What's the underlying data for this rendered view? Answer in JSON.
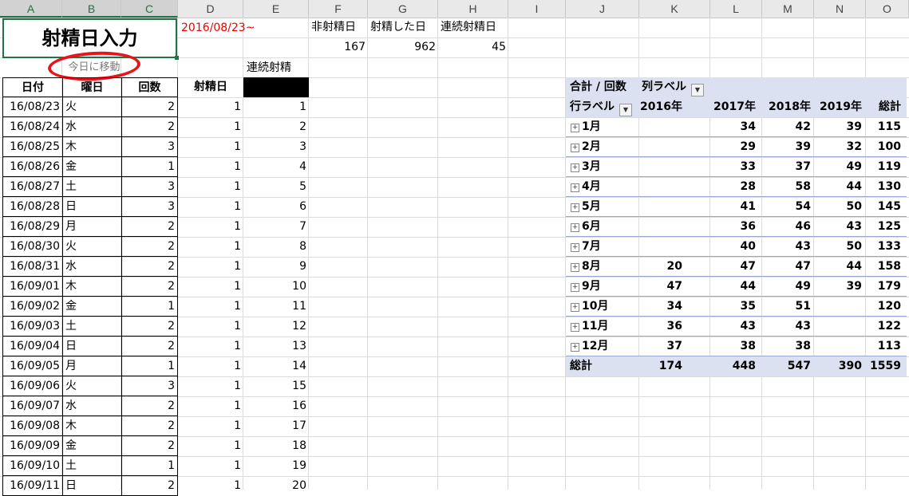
{
  "columns": [
    "A",
    "B",
    "C",
    "D",
    "E",
    "F",
    "G",
    "H",
    "I",
    "J",
    "K",
    "L",
    "M",
    "N",
    "O"
  ],
  "title": "射精日入力",
  "date_start": "2016/08/23~",
  "today_link": "今日に移動",
  "stats": {
    "labels": [
      "非射精日",
      "射精した日",
      "連続射精日"
    ],
    "values": [
      "167",
      "962",
      "45"
    ]
  },
  "streak_label": "連続射精",
  "headers": {
    "date": "日付",
    "weekday": "曜日",
    "count": "回数",
    "ejac_day": "射精日"
  },
  "rows": [
    {
      "date": "16/08/23",
      "weekday": "火",
      "count": "2",
      "day": "1",
      "streak": "1"
    },
    {
      "date": "16/08/24",
      "weekday": "水",
      "count": "2",
      "day": "1",
      "streak": "2"
    },
    {
      "date": "16/08/25",
      "weekday": "木",
      "count": "3",
      "day": "1",
      "streak": "3"
    },
    {
      "date": "16/08/26",
      "weekday": "金",
      "count": "1",
      "day": "1",
      "streak": "4"
    },
    {
      "date": "16/08/27",
      "weekday": "土",
      "count": "3",
      "day": "1",
      "streak": "5"
    },
    {
      "date": "16/08/28",
      "weekday": "日",
      "count": "3",
      "day": "1",
      "streak": "6"
    },
    {
      "date": "16/08/29",
      "weekday": "月",
      "count": "2",
      "day": "1",
      "streak": "7"
    },
    {
      "date": "16/08/30",
      "weekday": "火",
      "count": "2",
      "day": "1",
      "streak": "8"
    },
    {
      "date": "16/08/31",
      "weekday": "水",
      "count": "2",
      "day": "1",
      "streak": "9"
    },
    {
      "date": "16/09/01",
      "weekday": "木",
      "count": "2",
      "day": "1",
      "streak": "10"
    },
    {
      "date": "16/09/02",
      "weekday": "金",
      "count": "1",
      "day": "1",
      "streak": "11"
    },
    {
      "date": "16/09/03",
      "weekday": "土",
      "count": "2",
      "day": "1",
      "streak": "12"
    },
    {
      "date": "16/09/04",
      "weekday": "日",
      "count": "2",
      "day": "1",
      "streak": "13"
    },
    {
      "date": "16/09/05",
      "weekday": "月",
      "count": "1",
      "day": "1",
      "streak": "14"
    },
    {
      "date": "16/09/06",
      "weekday": "火",
      "count": "3",
      "day": "1",
      "streak": "15"
    },
    {
      "date": "16/09/07",
      "weekday": "水",
      "count": "2",
      "day": "1",
      "streak": "16"
    },
    {
      "date": "16/09/08",
      "weekday": "木",
      "count": "2",
      "day": "1",
      "streak": "17"
    },
    {
      "date": "16/09/09",
      "weekday": "金",
      "count": "2",
      "day": "1",
      "streak": "18"
    },
    {
      "date": "16/09/10",
      "weekday": "土",
      "count": "1",
      "day": "1",
      "streak": "19"
    },
    {
      "date": "16/09/11",
      "weekday": "日",
      "count": "2",
      "day": "1",
      "streak": "20"
    }
  ],
  "pivot": {
    "corner": "合計 / 回数",
    "col_label": "列ラベル",
    "row_label": "行ラベル",
    "years": [
      "2016年",
      "2017年",
      "2018年",
      "2019年",
      "総計"
    ],
    "rows": [
      {
        "label": "1月",
        "vals": [
          "",
          "34",
          "42",
          "39",
          "115"
        ]
      },
      {
        "label": "2月",
        "vals": [
          "",
          "29",
          "39",
          "32",
          "100"
        ]
      },
      {
        "label": "3月",
        "vals": [
          "",
          "33",
          "37",
          "49",
          "119"
        ]
      },
      {
        "label": "4月",
        "vals": [
          "",
          "28",
          "58",
          "44",
          "130"
        ]
      },
      {
        "label": "5月",
        "vals": [
          "",
          "41",
          "54",
          "50",
          "145"
        ]
      },
      {
        "label": "6月",
        "vals": [
          "",
          "36",
          "46",
          "43",
          "125"
        ]
      },
      {
        "label": "7月",
        "vals": [
          "",
          "40",
          "43",
          "50",
          "133"
        ]
      },
      {
        "label": "8月",
        "vals": [
          "20",
          "47",
          "47",
          "44",
          "158"
        ]
      },
      {
        "label": "9月",
        "vals": [
          "47",
          "44",
          "49",
          "39",
          "179"
        ]
      },
      {
        "label": "10月",
        "vals": [
          "34",
          "35",
          "51",
          "",
          "120"
        ]
      },
      {
        "label": "11月",
        "vals": [
          "36",
          "43",
          "43",
          "",
          "122"
        ]
      },
      {
        "label": "12月",
        "vals": [
          "37",
          "38",
          "38",
          "",
          "113"
        ]
      }
    ],
    "total_label": "総計",
    "totals": [
      "174",
      "448",
      "547",
      "390",
      "1559"
    ]
  }
}
